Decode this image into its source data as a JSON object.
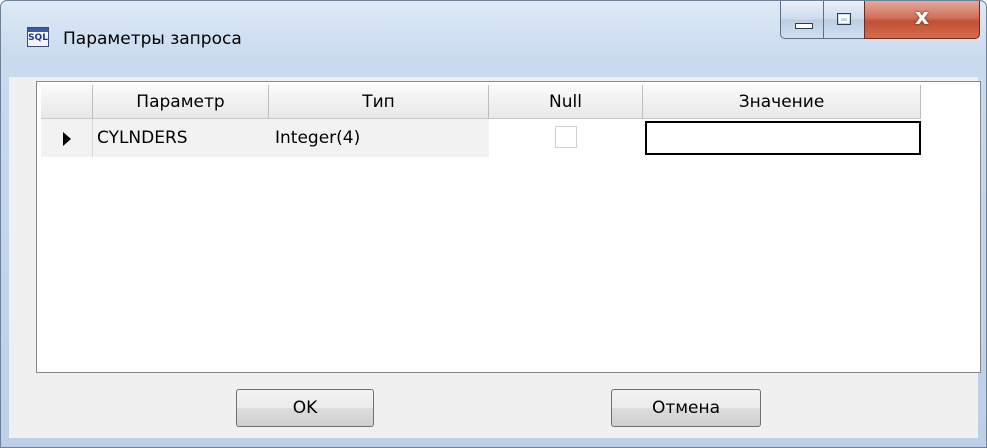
{
  "window": {
    "title": "Параметры запроса",
    "icon_text": "SQL"
  },
  "grid": {
    "columns": [
      "Параметр",
      "Тип",
      "Null",
      "Значение"
    ],
    "rows": [
      {
        "parameter": "CYLNDERS",
        "type": "Integer(4)",
        "null": false,
        "value": ""
      }
    ]
  },
  "buttons": {
    "ok": "OK",
    "cancel": "Отмена"
  }
}
